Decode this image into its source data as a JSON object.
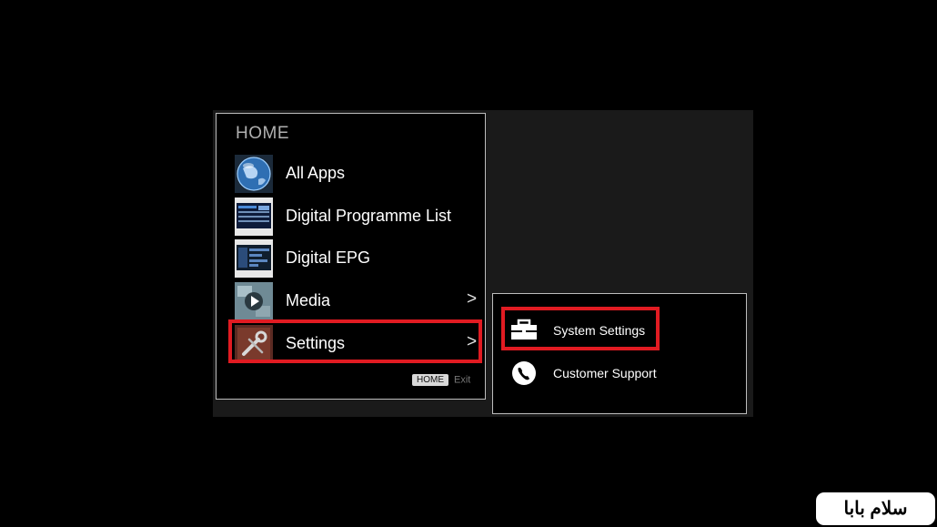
{
  "home_menu": {
    "title": "HOME",
    "items": [
      {
        "label": "All Apps",
        "icon": "globe-icon",
        "has_submenu": false
      },
      {
        "label": "Digital Programme List",
        "icon": "programme-list-thumbnail-icon",
        "has_submenu": false
      },
      {
        "label": "Digital EPG",
        "icon": "epg-thumbnail-icon",
        "has_submenu": false
      },
      {
        "label": "Media",
        "icon": "media-thumbnail-icon",
        "has_submenu": true
      },
      {
        "label": "Settings",
        "icon": "settings-tools-icon",
        "has_submenu": true,
        "selected": true
      }
    ],
    "chevron": ">",
    "hint": {
      "key": "HOME",
      "action": "Exit"
    }
  },
  "settings_submenu": {
    "items": [
      {
        "label": "System Settings",
        "icon": "toolbox-icon",
        "selected": true
      },
      {
        "label": "Customer Support",
        "icon": "phone-icon",
        "selected": false
      }
    ]
  },
  "watermark": {
    "text": "سلام بابا"
  },
  "colors": {
    "highlight": "#e11b22",
    "panel_border": "#bdbdbd",
    "background": "#000000"
  }
}
